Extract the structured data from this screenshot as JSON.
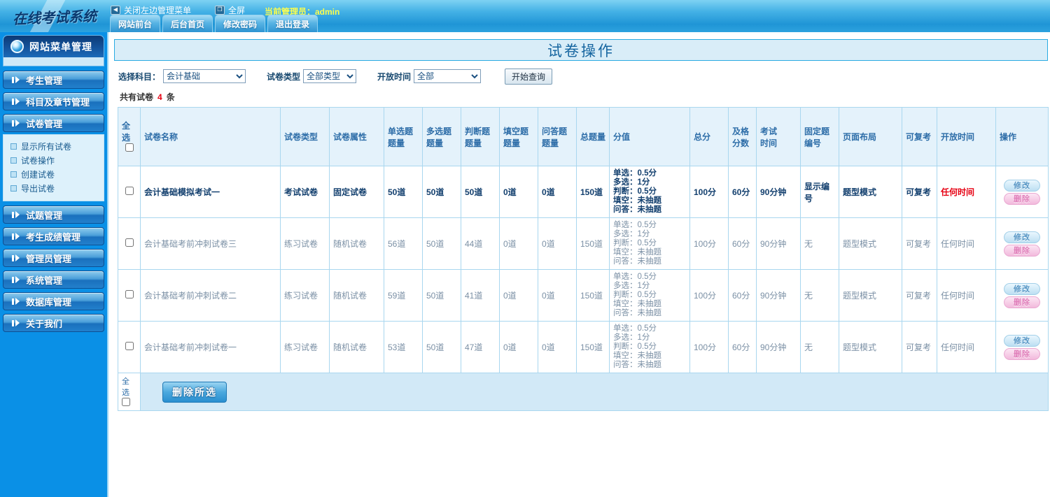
{
  "app": {
    "logo": "在线考试系统",
    "topbar": {
      "close_menu": "关闭左边管理菜单",
      "fullscreen": "全屏",
      "admin_label": "当前管理员：admin"
    },
    "tabs": [
      "网站前台",
      "后台首页",
      "修改密码",
      "退出登录"
    ]
  },
  "sidebar": {
    "header": "网站菜单管理",
    "groups": [
      "考生管理",
      "科目及章节管理",
      "试卷管理",
      "试题管理",
      "考生成绩管理",
      "管理员管理",
      "系统管理",
      "数据库管理",
      "关于我们"
    ],
    "submenu_of_paper": [
      "显示所有试卷",
      "试卷操作",
      "创建试卷",
      "导出试卷"
    ]
  },
  "main": {
    "title": "试卷操作",
    "filters": {
      "subject_label": "选择科目：",
      "subject_value": "会计基础",
      "type_label": "试卷类型",
      "type_value": "全部类型",
      "time_label": "开放时间",
      "time_value": "全部",
      "query_button": "开始查询"
    },
    "count": {
      "prefix": "共有试卷",
      "value": "4",
      "suffix": "条"
    },
    "table": {
      "headers": [
        "全选",
        "试卷名称",
        "试卷类型",
        "试卷属性",
        "单选题\n题量",
        "多选题\n题量",
        "判断题\n题量",
        "填空题\n题量",
        "问答题\n题量",
        "总题量",
        "分值",
        "总分",
        "及格\n分数",
        "考试\n时间",
        "固定题\n编号",
        "页面布局",
        "可复考",
        "开放时间",
        "操作"
      ],
      "action_modify": "修改",
      "action_delete": "删除",
      "rows": [
        {
          "name": "会计基础模拟考试一",
          "type": "考试试卷",
          "attr": "固定试卷",
          "single": "50道",
          "multi": "50道",
          "judge": "50道",
          "blank": "0道",
          "qa": "0道",
          "total_q": "150道",
          "score_detail": "单选：0.5分\n多选：1分\n判断：0.5分\n填空：未抽题\n问答：未抽题",
          "total_score": "100分",
          "pass_score": "60分",
          "exam_time": "90分钟",
          "fixed_no": "显示编号",
          "layout": "题型模式",
          "retake": "可复考",
          "open_time": "任何时间"
        },
        {
          "name": "会计基础考前冲刺试卷三",
          "type": "练习试卷",
          "attr": "随机试卷",
          "single": "56道",
          "multi": "50道",
          "judge": "44道",
          "blank": "0道",
          "qa": "0道",
          "total_q": "150道",
          "score_detail": "单选：0.5分\n多选：1分\n判断：0.5分\n填空：未抽题\n问答：未抽题",
          "total_score": "100分",
          "pass_score": "60分",
          "exam_time": "90分钟",
          "fixed_no": "无",
          "layout": "题型模式",
          "retake": "可复考",
          "open_time": "任何时间"
        },
        {
          "name": "会计基础考前冲刺试卷二",
          "type": "练习试卷",
          "attr": "随机试卷",
          "single": "59道",
          "multi": "50道",
          "judge": "41道",
          "blank": "0道",
          "qa": "0道",
          "total_q": "150道",
          "score_detail": "单选：0.5分\n多选：1分\n判断：0.5分\n填空：未抽题\n问答：未抽题",
          "total_score": "100分",
          "pass_score": "60分",
          "exam_time": "90分钟",
          "fixed_no": "无",
          "layout": "题型模式",
          "retake": "可复考",
          "open_time": "任何时间"
        },
        {
          "name": "会计基础考前冲刺试卷一",
          "type": "练习试卷",
          "attr": "随机试卷",
          "single": "53道",
          "multi": "50道",
          "judge": "47道",
          "blank": "0道",
          "qa": "0道",
          "total_q": "150道",
          "score_detail": "单选：0.5分\n多选：1分\n判断：0.5分\n填空：未抽题\n问答：未抽题",
          "total_score": "100分",
          "pass_score": "60分",
          "exam_time": "90分钟",
          "fixed_no": "无",
          "layout": "题型模式",
          "retake": "可复考",
          "open_time": "任何时间"
        }
      ]
    },
    "footer": {
      "select_all": "全选",
      "delete_button": "删除所选"
    }
  },
  "colors": {
    "sidebar_blue": "#0a90e6",
    "title_border_cyan": "#29abe2",
    "header_text_blue": "#2d6da8",
    "count_red": "#e60012",
    "open_time_red": "#e60012",
    "admin_yellow": "#ffff4d"
  }
}
